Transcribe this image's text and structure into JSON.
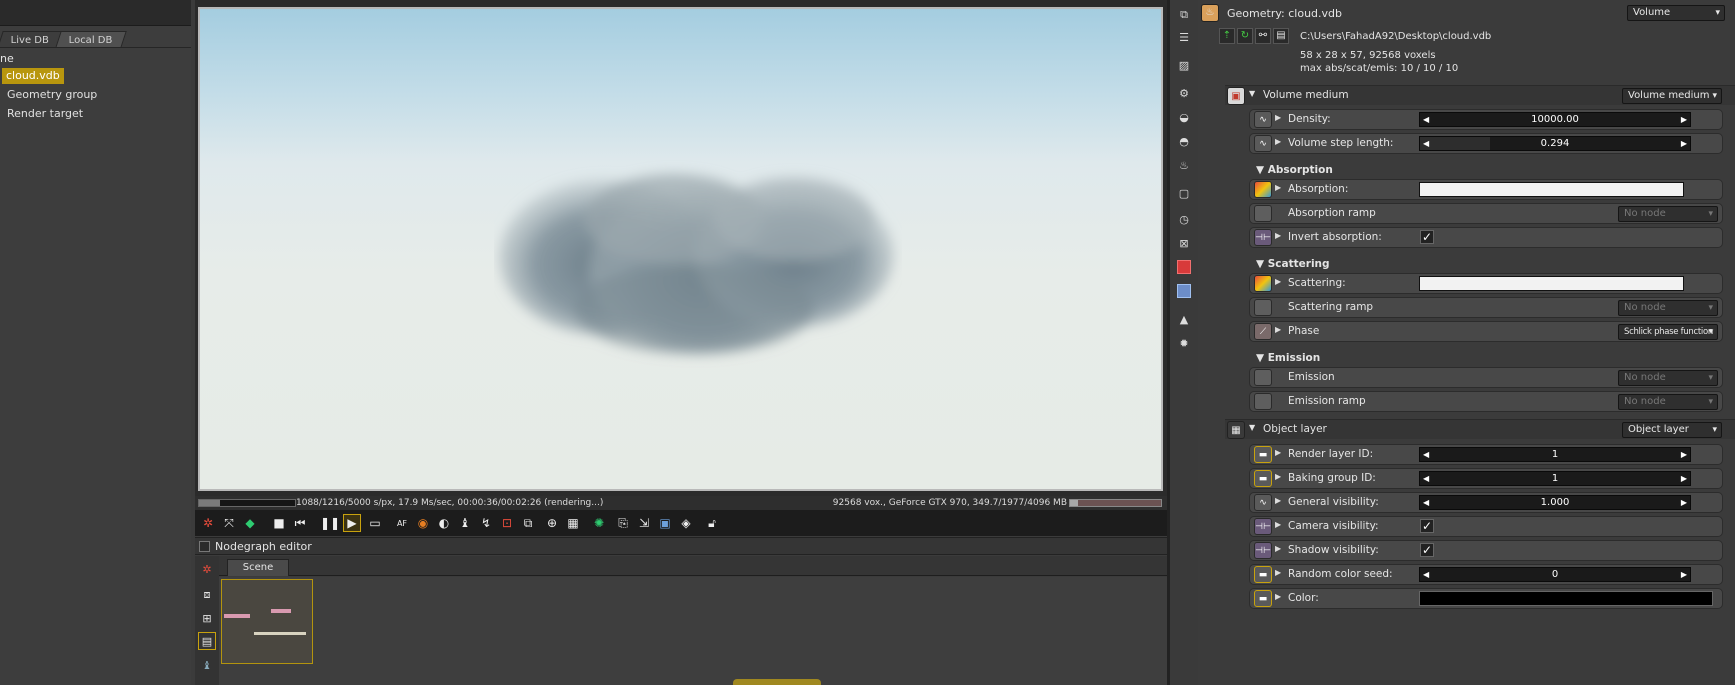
{
  "left_panel": {
    "tabs": [
      "Live DB",
      "Local DB"
    ],
    "root_label": "ne",
    "tree": [
      "cloud.vdb",
      "Geometry group",
      "Render target"
    ]
  },
  "status": {
    "render_info": "1088/1216/5000 s/px, 17.9 Ms/sec, 00:00:36/00:02:26 (rendering...)",
    "gpu_info": "92568 vox., GeForce GTX 970, 349.7/1977/4096 MB",
    "progress_fraction": 0.22
  },
  "toolbar": {
    "icons": [
      "recenter-view-icon",
      "fit-view-icon",
      "color-cube-icon",
      "stop-icon",
      "rewind-icon",
      "pause-icon",
      "play-icon",
      "screen-icon",
      "af-icon",
      "color-picker-icon",
      "material-picker-icon",
      "object-picker-icon",
      "camera-picker-icon",
      "region-icon",
      "export-icon",
      "zoom-icon",
      "grid-icon",
      "clay-mode-icon",
      "copy-icon",
      "paste-icon",
      "save-icon",
      "image-icon",
      "lock-icon"
    ]
  },
  "nodegraph": {
    "title": "Nodegraph editor",
    "tab": "Scene"
  },
  "inspector": {
    "title": "Geometry: cloud.vdb",
    "type_dropdown": "Volume",
    "path": "C:\\Users\\FahadA92\\Desktop\\cloud.vdb",
    "voxel_info": "58 x 28 x 57, 92568 voxels",
    "max_info": "max abs/scat/emis: 10 / 10 / 10",
    "volume_medium": {
      "label": "Volume medium",
      "dropdown": "Volume medium",
      "density_label": "Density:",
      "density_value": "10000.00",
      "step_label": "Volume step length:",
      "step_value": "0.294",
      "step_fill": 0.26
    },
    "absorption": {
      "section": "Absorption",
      "absorption_label": "Absorption:",
      "ramp_label": "Absorption ramp",
      "ramp_value": "No node",
      "invert_label": "Invert absorption:"
    },
    "scattering": {
      "section": "Scattering",
      "scattering_label": "Scattering:",
      "ramp_label": "Scattering ramp",
      "ramp_value": "No node",
      "phase_label": "Phase",
      "phase_value": "Schlick phase function"
    },
    "emission": {
      "section": "Emission",
      "emission_label": "Emission",
      "emission_value": "No node",
      "ramp_label": "Emission ramp",
      "ramp_value": "No node"
    },
    "object_layer": {
      "label": "Object layer",
      "dropdown": "Object layer",
      "render_layer_label": "Render layer ID:",
      "render_layer_value": "1",
      "baking_label": "Baking group ID:",
      "baking_value": "1",
      "visibility_label": "General visibility:",
      "visibility_value": "1.000",
      "camera_label": "Camera visibility:",
      "shadow_label": "Shadow visibility:",
      "seed_label": "Random color seed:",
      "seed_value": "0",
      "color_label": "Color:"
    }
  },
  "colors": {
    "accent": "#b8960e",
    "absorption_color": "#f2f2f2",
    "scattering_color": "#f2f2f2",
    "object_color": "#000000"
  }
}
